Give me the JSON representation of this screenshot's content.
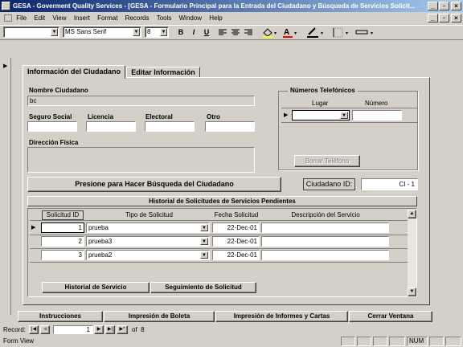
{
  "window": {
    "title": "GESA - Goverment Quality Services - [GESA - Formulario Principal para la Entrada del Ciudadano y Búsqueda de Servicios Solicit..."
  },
  "menu": [
    "File",
    "Edit",
    "View",
    "Insert",
    "Format",
    "Records",
    "Tools",
    "Window",
    "Help"
  ],
  "toolbar": {
    "object_combo": "",
    "font_name": "MS Sans Serif",
    "font_size": "8",
    "bold": "B",
    "italic": "I",
    "underline": "U"
  },
  "tabs": {
    "active": "Información del Ciudadano",
    "inactive": "Editar Información"
  },
  "citizen": {
    "name_label": "Nombre Ciudadano",
    "name_value": "bc",
    "ssn_label": "Seguro Social",
    "license_label": "Licencia",
    "electoral_label": "Electoral",
    "other_label": "Otro",
    "address_label": "Dirección Física"
  },
  "phones": {
    "title": "Números Telefónicos",
    "col_place": "Lugar",
    "col_number": "Número",
    "delete_button": "Borrar Teléfono"
  },
  "search_button": "Presione para Hacer Búsqueda del Ciudadano",
  "citizen_id": {
    "label": "Ciudadano ID:",
    "value": "CI - 1"
  },
  "history": {
    "title": "Historial de Solicitudes de Servicios Pendientes",
    "columns": [
      "Solicitud ID",
      "Tipo de Solicitud",
      "Fecha Solicitud",
      "Descripción del Servicio"
    ],
    "rows": [
      {
        "id": "1",
        "type": "prueba",
        "date": "22-Dec-01",
        "desc": ""
      },
      {
        "id": "2",
        "type": "prueba3",
        "date": "22-Dec-01",
        "desc": ""
      },
      {
        "id": "3",
        "type": "prueba2",
        "date": "22-Dec-01",
        "desc": ""
      }
    ],
    "btn_history": "Historial de Servicio",
    "btn_followup": "Seguimiento de Solicitud"
  },
  "footer_buttons": [
    "Instrucciones",
    "Impresión de Boleta",
    "Impresión de Informes y Cartas",
    "Cerrar Ventana"
  ],
  "navigator": {
    "label": "Record:",
    "current": "1",
    "of_text": "of  8"
  },
  "status": {
    "left": "Form View",
    "num": "NUM"
  }
}
